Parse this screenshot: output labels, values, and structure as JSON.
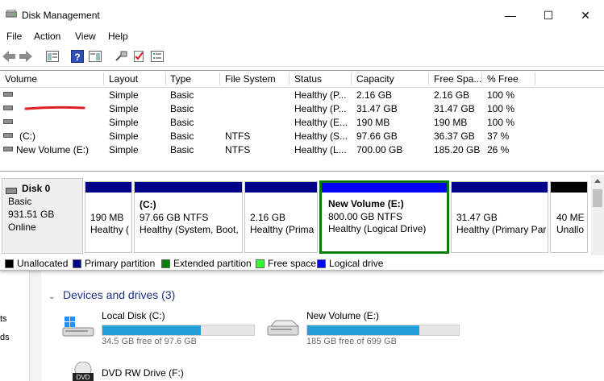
{
  "window": {
    "title": "Disk Management",
    "minimize": "—",
    "maximize": "☐",
    "close": "✕"
  },
  "menu": [
    "File",
    "Action",
    "View",
    "Help"
  ],
  "columns": [
    "Volume",
    "Layout",
    "Type",
    "File System",
    "Status",
    "Capacity",
    "Free Spa...",
    "% Free"
  ],
  "volumes": [
    {
      "volume": "",
      "layout": "Simple",
      "type": "Basic",
      "fs": "",
      "status": "Healthy (P...",
      "capacity": "2.16 GB",
      "free": "2.16 GB",
      "pct": "100 %"
    },
    {
      "volume": "",
      "layout": "Simple",
      "type": "Basic",
      "fs": "",
      "status": "Healthy (P...",
      "capacity": "31.47 GB",
      "free": "31.47 GB",
      "pct": "100 %"
    },
    {
      "volume": "",
      "layout": "Simple",
      "type": "Basic",
      "fs": "",
      "status": "Healthy (E...",
      "capacity": "190 MB",
      "free": "190 MB",
      "pct": "100 %"
    },
    {
      "volume": "(C:)",
      "layout": "Simple",
      "type": "Basic",
      "fs": "NTFS",
      "status": "Healthy (S...",
      "capacity": "97.66 GB",
      "free": "36.37 GB",
      "pct": "37 %"
    },
    {
      "volume": "New Volume (E:)",
      "layout": "Simple",
      "type": "Basic",
      "fs": "NTFS",
      "status": "Healthy (L...",
      "capacity": "700.00 GB",
      "free": "185.20 GB",
      "pct": "26 %"
    }
  ],
  "disk": {
    "name": "Disk 0",
    "type": "Basic",
    "size": "931.51 GB",
    "state": "Online"
  },
  "partitions": [
    {
      "title": "",
      "size": "190 MB",
      "status": "Healthy ("
    },
    {
      "title": "(C:)",
      "size": "97.66 GB NTFS",
      "status": "Healthy (System, Boot,"
    },
    {
      "title": "",
      "size": "2.16 GB",
      "status": "Healthy (Prima"
    },
    {
      "title": "New Volume  (E:)",
      "size": "800.00 GB NTFS",
      "status": "Healthy (Logical Drive)"
    },
    {
      "title": "",
      "size": "31.47 GB",
      "status": "Healthy (Primary Par"
    },
    {
      "title": "",
      "size": "40 ME",
      "status": "Unallo"
    }
  ],
  "legend": [
    {
      "label": "Unallocated",
      "color": "#000000"
    },
    {
      "label": "Primary partition",
      "color": "#00008b"
    },
    {
      "label": "Extended partition",
      "color": "#008000"
    },
    {
      "label": "Free space",
      "color": "#33ff33"
    },
    {
      "label": "Logical drive",
      "color": "#0000ff"
    }
  ],
  "explorer": {
    "left_labels": [
      "ts",
      "ds"
    ],
    "section": "Devices and drives (3)",
    "drives": [
      {
        "name": "Local Disk (C:)",
        "free": "34.5 GB free of 97.6 GB",
        "used_fraction": 0.65
      },
      {
        "name": "New Volume (E:)",
        "free": "185 GB free of 699 GB",
        "used_fraction": 0.74
      },
      {
        "name": "DVD RW Drive (F:)",
        "dvd_label": "DVD"
      }
    ]
  }
}
